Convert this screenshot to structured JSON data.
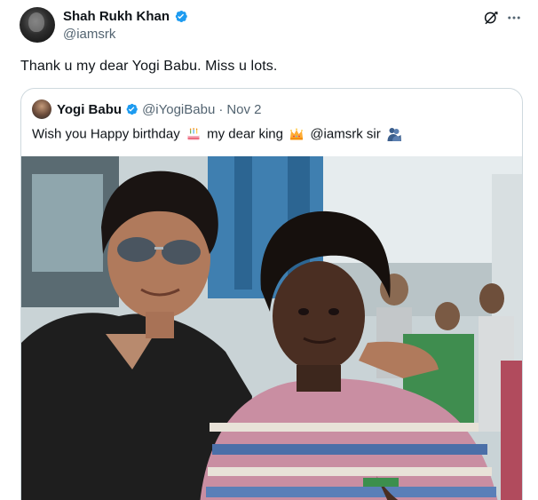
{
  "tweet": {
    "author": {
      "display_name": "Shah Rukh Khan",
      "handle": "@iamsrk",
      "verified": true
    },
    "text": "Thank u my dear Yogi Babu. Miss u lots.",
    "actions": {
      "grok_icon": "grok-icon",
      "more_icon": "more-icon"
    }
  },
  "quote": {
    "author": {
      "display_name": "Yogi Babu",
      "handle": "@iYogiBabu",
      "verified": true
    },
    "separator": "·",
    "date": "Nov 2",
    "text_parts": {
      "part1": "Wish you Happy birthday",
      "part2": "my dear  king",
      "part3": "@iamsrk sir"
    },
    "emojis": [
      "birthday-cake-icon",
      "crown-icon",
      "people-hugging-icon"
    ]
  },
  "colors": {
    "verified_blue": "#1d9bf0",
    "text_primary": "#0f1419",
    "text_secondary": "#536471",
    "border": "#cfd9de"
  }
}
